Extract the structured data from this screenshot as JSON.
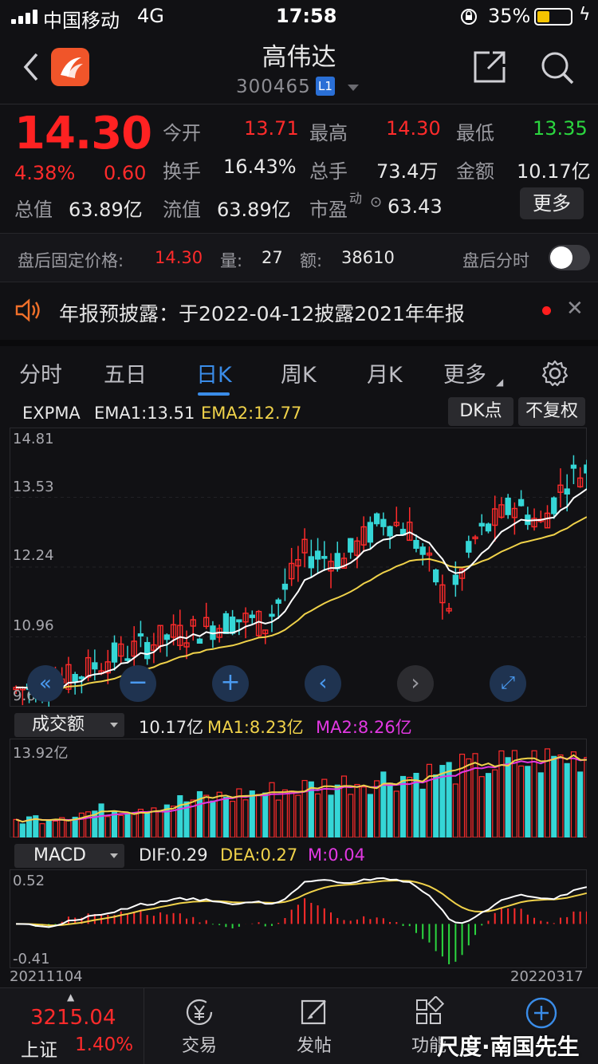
{
  "status_bar": {
    "carrier": "中国移动",
    "network": "4G",
    "time": "17:58",
    "battery": "35%"
  },
  "header": {
    "title": "高伟达",
    "code": "300465",
    "level_badge": "L1",
    "share_icon": "share-icon",
    "search_icon": "search-icon"
  },
  "quote": {
    "price": "14.30",
    "change_pct": "4.38%",
    "change": "0.60",
    "open_label": "今开",
    "open": "13.71",
    "high_label": "最高",
    "high": "14.30",
    "low_label": "最低",
    "low": "13.35",
    "turnover_label": "换手",
    "turnover": "16.43%",
    "volume_label": "总手",
    "volume": "73.4万",
    "amount_label": "金额",
    "amount": "10.17亿",
    "total_cap_label": "总值",
    "total_cap": "63.89亿",
    "float_cap_label": "流值",
    "float_cap": "63.89亿",
    "pe_label": "市盈",
    "pe_sup": "动",
    "pe": "63.43",
    "more_label": "更多"
  },
  "after_hours": {
    "label": "盘后固定价格:",
    "price": "14.30",
    "vol_label": "量:",
    "vol": "27",
    "amt_label": "额:",
    "amt": "38610",
    "timeshare_label": "盘后分时"
  },
  "notice": {
    "text": "年报预披露：于2022-04-12披露2021年年报"
  },
  "tabs": [
    {
      "label": "分时"
    },
    {
      "label": "五日"
    },
    {
      "label": "日K"
    },
    {
      "label": "周K"
    },
    {
      "label": "月K"
    },
    {
      "label": "更多"
    }
  ],
  "kline": {
    "indicator": "EXPMA",
    "ema1": "EMA1:13.51",
    "ema2": "EMA2:12.77",
    "dk_label": "DK点",
    "adjust_label": "不复权",
    "y_labels": [
      "14.81",
      "13.53",
      "12.24",
      "10.96",
      "9.68"
    ],
    "y_values": [
      14.81,
      13.53,
      12.24,
      10.96,
      9.68
    ]
  },
  "volume": {
    "selector": "成交额",
    "value": "10.17亿",
    "ma1": "MA1:8.23亿",
    "ma2": "MA2:8.26亿",
    "y_max": "13.92亿"
  },
  "macd": {
    "selector": "MACD",
    "dif": "DIF:0.29",
    "dea": "DEA:0.27",
    "m": "M:0.04",
    "y_max": "0.52",
    "y_min": "-0.41"
  },
  "dates": {
    "start": "20211104",
    "end": "20220317"
  },
  "colors": {
    "up": "#ff2b2b",
    "down": "#35d6d6",
    "ema1": "#ffffff",
    "ema2": "#f0d24a",
    "ma2": "#e238e2",
    "accent": "#3a8ce8"
  },
  "bottom_nav": {
    "index_value": "3215.04",
    "index_name": "上证",
    "index_pct": "1.40%",
    "items": [
      {
        "label": "交易"
      },
      {
        "label": "发帖"
      },
      {
        "label": "功能"
      }
    ]
  },
  "watermark": "尺度·南国先生"
}
